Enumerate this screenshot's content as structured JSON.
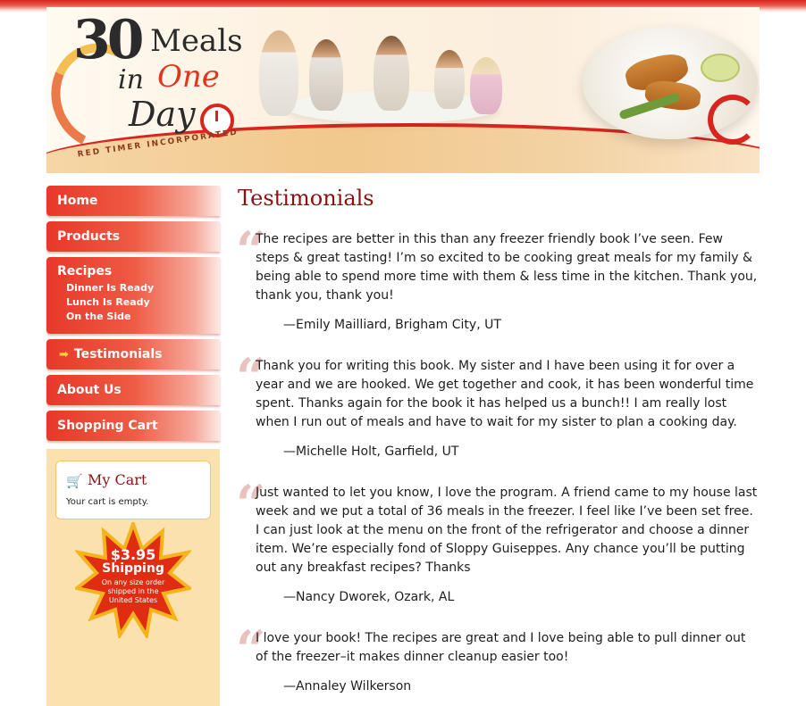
{
  "banner": {
    "logo": {
      "number": "30",
      "line1": "Meals",
      "line2_in": "in",
      "line2_one": "One",
      "line3": "Day",
      "tagline": "RED TIMER INCORPORATED"
    }
  },
  "nav": {
    "home": "Home",
    "products": "Products",
    "recipes": "Recipes",
    "recipe_subitems": [
      "Dinner Is Ready",
      "Lunch Is Ready",
      "On the Side"
    ],
    "testimonials": "Testimonials",
    "about": "About Us",
    "cart": "Shopping Cart"
  },
  "cart": {
    "title": "My Cart",
    "status": "Your cart is empty."
  },
  "promo": {
    "price": "$3.95",
    "label": "Shipping",
    "note_lines": [
      "On any size order",
      "shipped in the",
      "United States"
    ]
  },
  "page": {
    "title": "Testimonials"
  },
  "testimonials": [
    {
      "text": "The recipes are better in this than any freezer friendly book I’ve seen. Few steps & great tasting! I’m so excited to be cooking great meals for my family & being able to spend more time with them & less time in the kitchen. Thank you, thank you, thank you!",
      "author": "—Emily Mailliard, Brigham City, UT"
    },
    {
      "text": "Thank you for writing this book. My sister and I have been using it for over a year and we are hooked. We get together and cook, it has been wonderful time spent. Thanks again for the book it has helped us a bunch!! I am really lost when I run out of meals and have to wait for my sister to plan a cooking day.",
      "author": "—Michelle Holt, Garfield, UT"
    },
    {
      "text": "Just wanted to let you know, I love the program. A friend came to my house last week and we put a total of 36 meals in the freezer. I feel like I’ve been set free. I can just look at the menu on the front of the refrigerator and choose a dinner item. We’re especially fond of Sloppy Guiseppes. Any chance you’ll be putting out any breakfast recipes? Thanks",
      "author": "—Nancy Dworek, Ozark, AL"
    },
    {
      "text": "I love your book! The recipes are great and I love being able to pull dinner out of the freezer–it makes dinner cleanup easier too!",
      "author": "—Annaley Wilkerson"
    }
  ],
  "colors": {
    "accent": "#d8261e",
    "title": "#8c1010",
    "sidebar_bg": "#fbe1ad"
  },
  "icons": {
    "cart": "shopping-cart-icon",
    "current": "arrow-right-icon",
    "quote": "quote-icon"
  }
}
